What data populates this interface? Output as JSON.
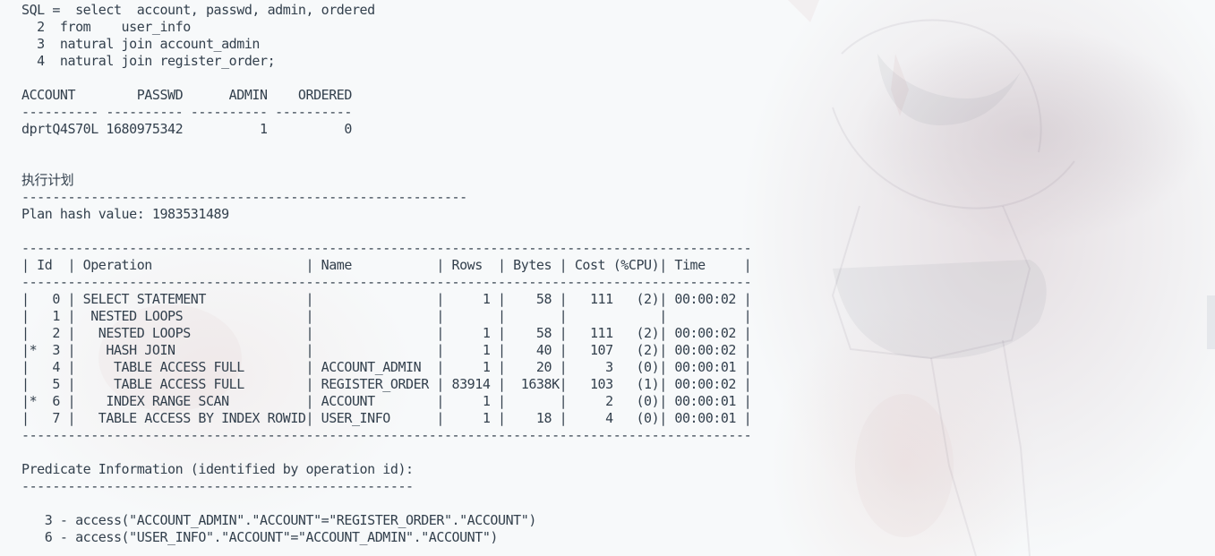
{
  "terminal": {
    "lines": [
      "SQL =  select  account, passwd, admin, ordered",
      "  2  from    user_info",
      "  3  natural join account_admin",
      "  4  natural join register_order;",
      "",
      "ACCOUNT        PASSWD      ADMIN    ORDERED",
      "---------- ---------- ---------- ----------",
      "dprtQ4S70L 1680975342          1          0",
      "",
      "",
      "执行计划",
      "----------------------------------------------------------",
      "Plan hash value: 1983531489",
      "",
      "-----------------------------------------------------------------------------------------------",
      "| Id  | Operation                    | Name           | Rows  | Bytes | Cost (%CPU)| Time     |",
      "-----------------------------------------------------------------------------------------------",
      "|   0 | SELECT STATEMENT             |                |     1 |    58 |   111   (2)| 00:00:02 |",
      "|   1 |  NESTED LOOPS                |                |       |       |            |          |",
      "|   2 |   NESTED LOOPS               |                |     1 |    58 |   111   (2)| 00:00:02 |",
      "|*  3 |    HASH JOIN                 |                |     1 |    40 |   107   (2)| 00:00:02 |",
      "|   4 |     TABLE ACCESS FULL        | ACCOUNT_ADMIN  |     1 |    20 |     3   (0)| 00:00:01 |",
      "|   5 |     TABLE ACCESS FULL        | REGISTER_ORDER | 83914 |  1638K|   103   (1)| 00:00:02 |",
      "|*  6 |    INDEX RANGE SCAN          | ACCOUNT        |     1 |       |     2   (0)| 00:00:01 |",
      "|   7 |   TABLE ACCESS BY INDEX ROWID| USER_INFO      |     1 |    18 |     4   (0)| 00:00:01 |",
      "-----------------------------------------------------------------------------------------------",
      "",
      "Predicate Information (identified by operation id):",
      "---------------------------------------------------",
      "",
      "   3 - access(\"ACCOUNT_ADMIN\".\"ACCOUNT\"=\"REGISTER_ORDER\".\"ACCOUNT\")",
      "   6 - access(\"USER_INFO\".\"ACCOUNT\"=\"ACCOUNT_ADMIN\".\"ACCOUNT\")"
    ]
  },
  "colors": {
    "background": "#f7f9fa",
    "text": "#33404d"
  }
}
